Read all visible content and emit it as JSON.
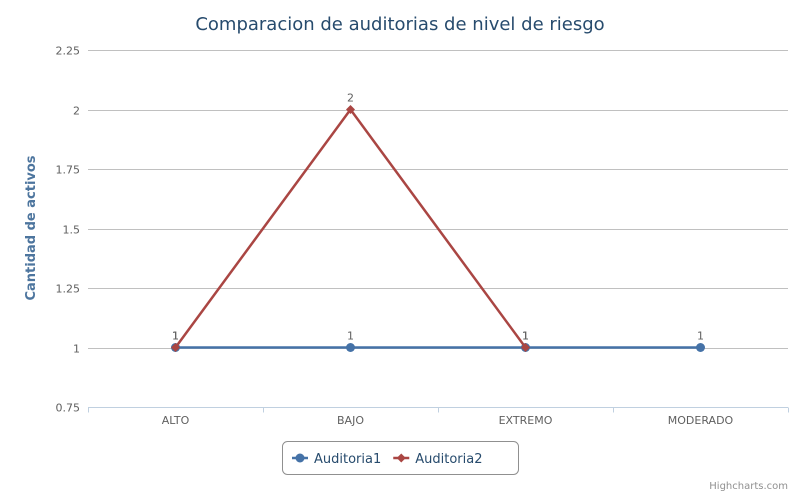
{
  "chart_data": {
    "type": "line",
    "title": "Comparacion de auditorias de nivel de riesgo",
    "ylabel": "Cantidad de activos",
    "xlabel": "",
    "categories": [
      "ALTO",
      "BAJO",
      "EXTREMO",
      "MODERADO"
    ],
    "ylim": [
      0.75,
      2.25
    ],
    "yticks": [
      0.75,
      1,
      1.25,
      1.5,
      1.75,
      2,
      2.25
    ],
    "grid": true,
    "legend": "bottom-center",
    "series": [
      {
        "name": "Auditoria1",
        "values": [
          1,
          1,
          1,
          1
        ],
        "color": "#4572a7",
        "marker": "circle"
      },
      {
        "name": "Auditoria2",
        "values": [
          1,
          2,
          1,
          null
        ],
        "color": "#aa4643",
        "marker": "diamond"
      }
    ],
    "data_labels": true
  },
  "credits": "Highcharts.com"
}
